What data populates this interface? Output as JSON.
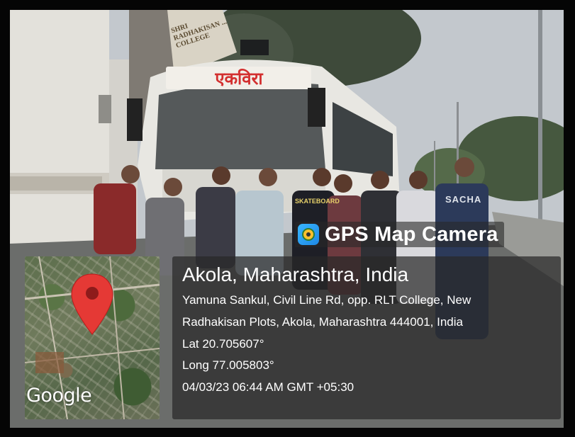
{
  "photo": {
    "bus_destination_sign": "एकविरा",
    "building_sign": "SHRI RADHAKISAN ... COLLEGE",
    "shirt_print": "SKATEBOARD",
    "other_shirt_print": "SACHA"
  },
  "overlay": {
    "app_name": "GPS Map Camera",
    "city": "Akola, Maharashtra, India",
    "address_line_1": "Yamuna Sankul, Civil Line Rd, opp. RLT College, New",
    "address_line_2": "Radhakisan Plots, Akola, Maharashtra 444001, India",
    "latitude": "Lat 20.705607°",
    "longitude": "Long 77.005803°",
    "datetime": "04/03/23 06:44 AM GMT +05:30",
    "map_logo": "Google"
  },
  "colors": {
    "map_pin": "#e53935",
    "panel_background": "rgba(40,40,40,0.72)",
    "bus_sign_text": "#d32f2f"
  },
  "icons": [
    "gps-map-camera-app-icon",
    "map-pin-icon"
  ]
}
